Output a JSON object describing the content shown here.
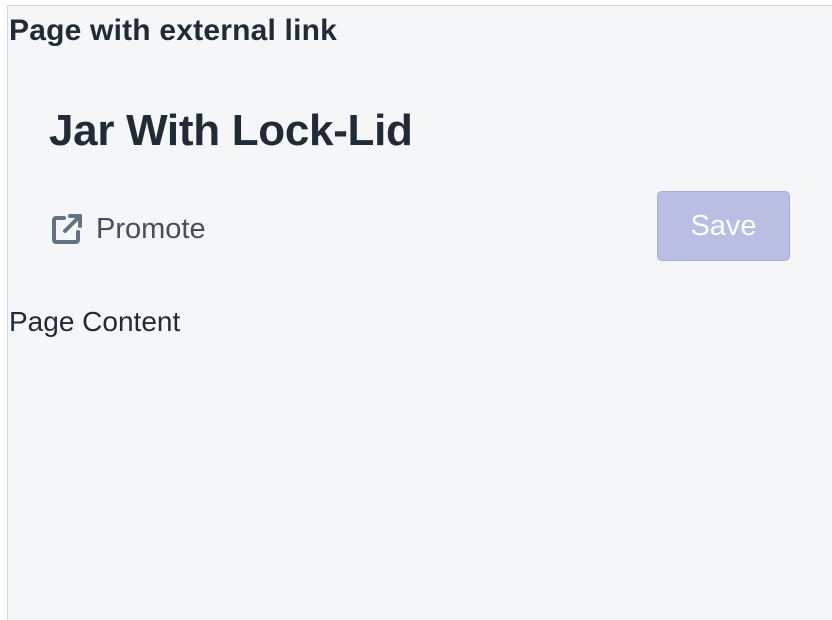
{
  "story": {
    "title": "Page with external link"
  },
  "page": {
    "title": "Jar With Lock-Lid",
    "content": "Page Content"
  },
  "secondary_actions": [
    {
      "label": "Promote",
      "icon": "external-link-icon"
    }
  ],
  "primary_action": {
    "label": "Save",
    "disabled": true
  },
  "colors": {
    "background": "#f4f6f8",
    "text": "#212b36",
    "action_text": "#454f5b",
    "icon": "#637381",
    "primary_disabled": "#b3b8e0"
  }
}
